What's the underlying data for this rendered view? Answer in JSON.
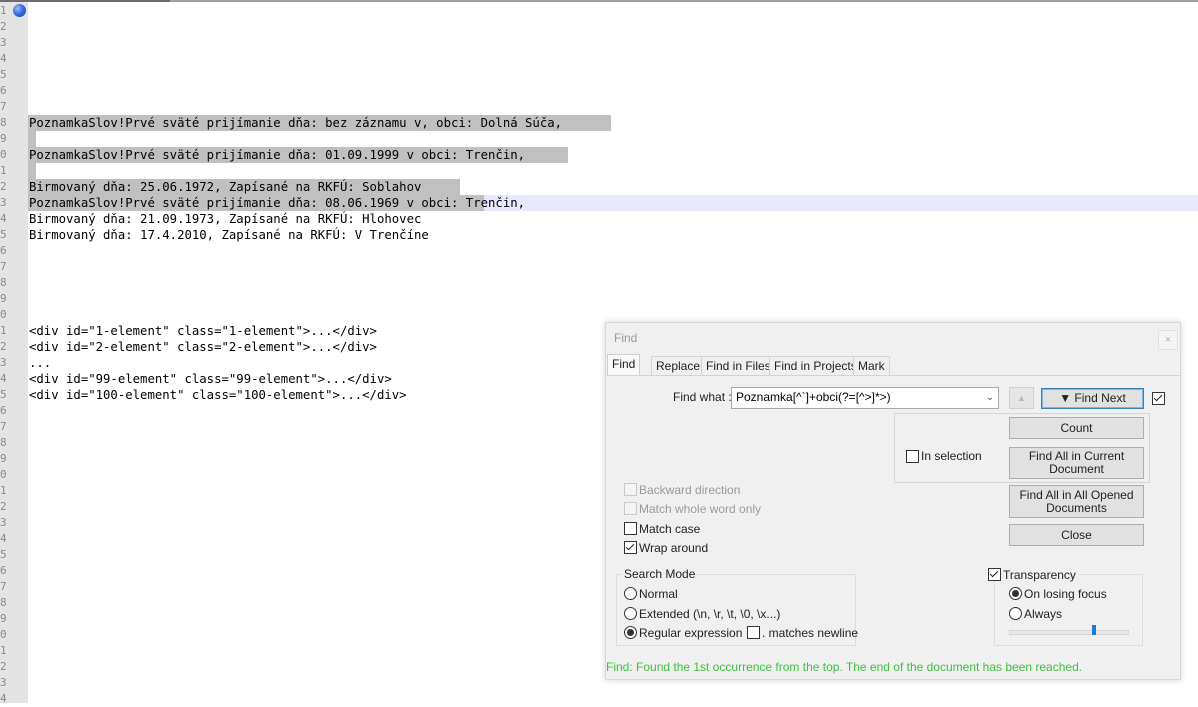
{
  "editor": {
    "line_numbers": [
      "1",
      "2",
      "3",
      "4",
      "5",
      "6",
      "7",
      "8",
      "9",
      "0",
      "1",
      "2",
      "3",
      "4",
      "5",
      "6",
      "7",
      "8",
      "9",
      "0",
      "1",
      "2",
      "3",
      "4",
      "5",
      "6",
      "7",
      "8",
      "9",
      "0",
      "1",
      "2",
      "3",
      "4",
      "5",
      "6",
      "7",
      "8",
      "9",
      "0",
      "1",
      "2",
      "3",
      "4"
    ],
    "lines": [
      {
        "row": 8,
        "text": "PoznamkaSlov!Prvé sväté prijímanie dňa: bez záznamu v, obci: Dolná Súča, "
      },
      {
        "row": 10,
        "text": "PoznamkaSlov!Prvé sväté prijímanie dňa: 01.09.1999 v obci: Trenčin, "
      },
      {
        "row": 12,
        "text": "Birmovaný dňa: 25.06.1972, Zapísané na RKFÚ: Soblahov "
      },
      {
        "row": 13,
        "text": "PoznamkaSlov!Prvé sväté prijímanie dňa: 08.06.1969 v obci: Trenčin,"
      },
      {
        "row": 14,
        "text": "Birmovaný dňa: 21.09.1973, Zapísané na RKFÚ: Hlohovec"
      },
      {
        "row": 15,
        "text": "Birmovaný dňa: 17.4.2010, Zapísané na RKFÚ: V Trenčíne"
      },
      {
        "row": 21,
        "text": "<div id=\"1-element\" class=\"1-element\">...</div>"
      },
      {
        "row": 22,
        "text": "<div id=\"2-element\" class=\"2-element\">...</div>"
      },
      {
        "row": 23,
        "text": "..."
      },
      {
        "row": 24,
        "text": "<div id=\"99-element\" class=\"99-element\">...</div>"
      },
      {
        "row": 25,
        "text": "<div id=\"100-element\" class=\"100-element\">...</div>"
      }
    ]
  },
  "find_dialog": {
    "title": "Find",
    "close_glyph": "×",
    "tabs": [
      "Find",
      "Replace",
      "Find in Files",
      "Find in Projects",
      "Mark"
    ],
    "find_what_label": "Find what :",
    "find_what_value": "Poznamka[^`]+obci(?=[^>]*>)",
    "up_glyph": "▲",
    "find_next_label": "▼ Find Next",
    "count_label": "Count",
    "in_selection_label": "In selection",
    "find_all_current_label": "Find All in Current Document",
    "find_all_opened_label": "Find All in All Opened Documents",
    "close_label": "Close",
    "backward_label": "Backward direction",
    "whole_word_label": "Match whole word only",
    "match_case_label": "Match case",
    "wrap_around_label": "Wrap around",
    "search_mode_title": "Search Mode",
    "mode_normal": "Normal",
    "mode_extended": "Extended (\\n, \\r, \\t, \\0, \\x...)",
    "mode_regex": "Regular expression",
    "matches_newline_label": ". matches newline",
    "transparency_label": "Transparency",
    "on_losing_focus_label": "On losing focus",
    "always_label": "Always",
    "transparency_level": 0.72,
    "status_text": "Find: Found the 1st occurrence from the top. The end of the document has been reached.",
    "status_color": "#3fbf3f"
  }
}
